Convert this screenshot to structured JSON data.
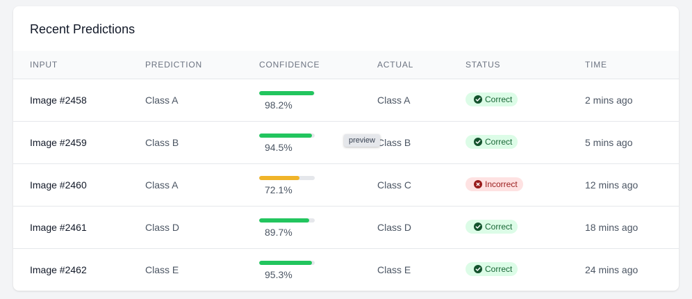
{
  "title": "Recent Predictions",
  "columns": {
    "input": "INPUT",
    "prediction": "PREDICTION",
    "confidence": "CONFIDENCE",
    "actual": "ACTUAL",
    "status": "STATUS",
    "time": "TIME"
  },
  "rows": [
    {
      "input": "Image #2458",
      "prediction": "Class A",
      "confidence": 98.2,
      "confidence_label": "98.2%",
      "actual": "Class A",
      "status": "Correct",
      "time": "2 mins ago",
      "bar_color": "#22c55e"
    },
    {
      "input": "Image #2459",
      "prediction": "Class B",
      "confidence": 94.5,
      "confidence_label": "94.5%",
      "actual": "Class B",
      "status": "Correct",
      "time": "5 mins ago",
      "bar_color": "#22c55e"
    },
    {
      "input": "Image #2460",
      "prediction": "Class A",
      "confidence": 72.1,
      "confidence_label": "72.1%",
      "actual": "Class C",
      "status": "Incorrect",
      "time": "12 mins ago",
      "bar_color": "#f0b429"
    },
    {
      "input": "Image #2461",
      "prediction": "Class D",
      "confidence": 89.7,
      "confidence_label": "89.7%",
      "actual": "Class D",
      "status": "Correct",
      "time": "18 mins ago",
      "bar_color": "#22c55e"
    },
    {
      "input": "Image #2462",
      "prediction": "Class E",
      "confidence": 95.3,
      "confidence_label": "95.3%",
      "actual": "Class E",
      "status": "Correct",
      "time": "24 mins ago",
      "bar_color": "#22c55e"
    }
  ],
  "tooltip": "preview",
  "icons": {
    "correct": "check-circle-icon",
    "incorrect": "x-circle-icon"
  }
}
